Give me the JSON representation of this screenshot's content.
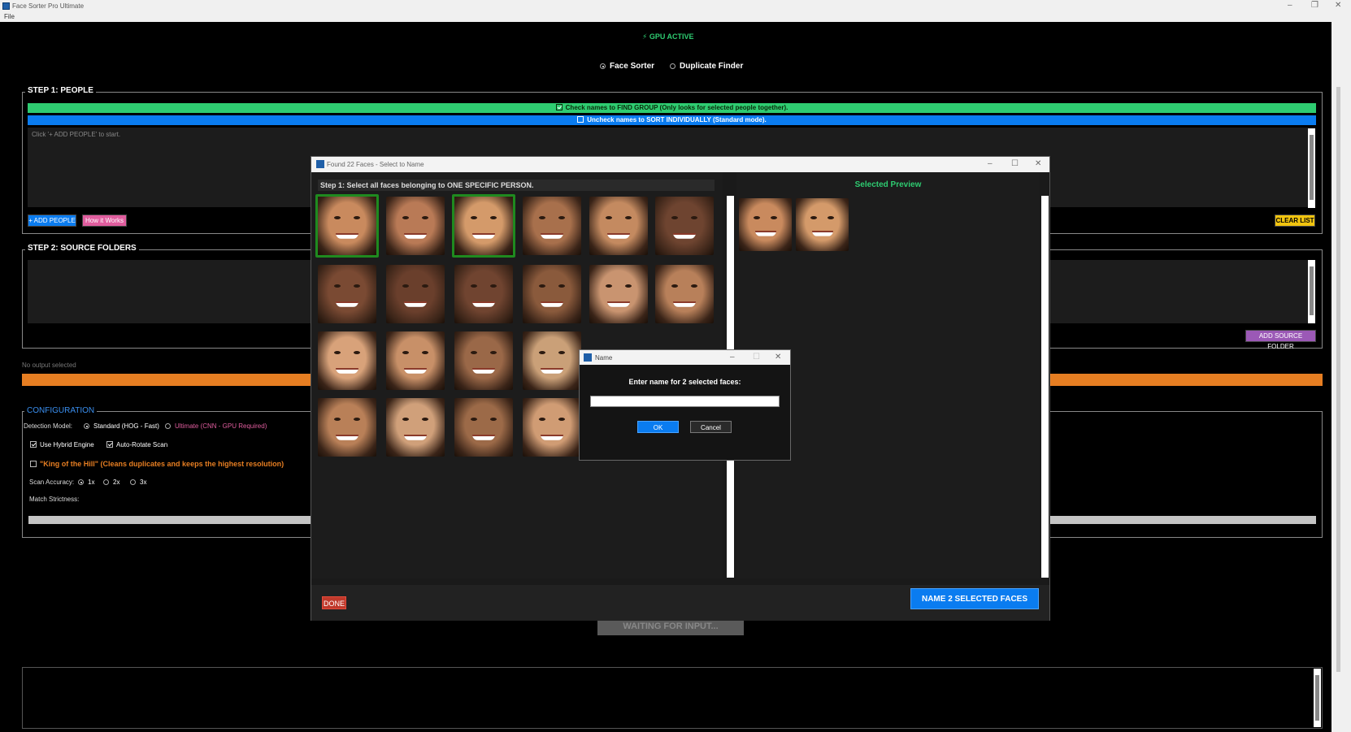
{
  "window": {
    "title": "Face Sorter Pro Ultimate",
    "menu_file": "File"
  },
  "status": {
    "gpu": "⚡ GPU ACTIVE"
  },
  "modes": {
    "face_sorter": "Face Sorter",
    "duplicate_finder": "Duplicate Finder"
  },
  "step1": {
    "title": "STEP 1: PEOPLE",
    "banner_group": "Check names to FIND GROUP (Only looks for selected people together).",
    "banner_individual": "Uncheck names to SORT INDIVIDUALLY (Standard mode).",
    "hint": "Click '+ ADD PEOPLE' to start.",
    "add_people": "+ ADD PEOPLE",
    "how_it_works": "How it Works",
    "clear_list": "CLEAR LIST"
  },
  "step2": {
    "title": "STEP 2: SOURCE FOLDERS",
    "add_source": "ADD SOURCE FOLDER"
  },
  "output": {
    "label": "No output selected"
  },
  "config": {
    "title": "CONFIGURATION",
    "detection_label": "Detection Model:",
    "standard": "Standard (HOG - Fast)",
    "ultimate": "Ultimate (CNN - GPU Required)",
    "hybrid": "Use Hybrid Engine",
    "autorotate": "Auto-Rotate Scan",
    "king": "\"King of the Hill\" (Cleans duplicates and keeps the highest resolution)",
    "scan_label": "Scan Accuracy:",
    "acc_1x": "1x",
    "acc_2x": "2x",
    "acc_3x": "3x",
    "strictness": "Match Strictness:"
  },
  "waiting": "WAITING FOR INPUT...",
  "faces_dialog": {
    "title": "Found 22 Faces - Select to Name",
    "step": "Step 1: Select all faces belonging to ONE SPECIFIC PERSON.",
    "preview_title": "Selected Preview",
    "done": "DONE",
    "name_button": "NAME 2 SELECTED FACES"
  },
  "name_dialog": {
    "title": "Name",
    "prompt": "Enter name for 2 selected faces:",
    "value": "",
    "ok": "OK",
    "cancel": "Cancel"
  },
  "colors": {
    "green": "#27ae60",
    "blue": "#0a7cf0",
    "orange": "#e67e22",
    "pink": "#e05d9e",
    "purple": "#9b59b6",
    "yellow": "#f1c40f"
  }
}
